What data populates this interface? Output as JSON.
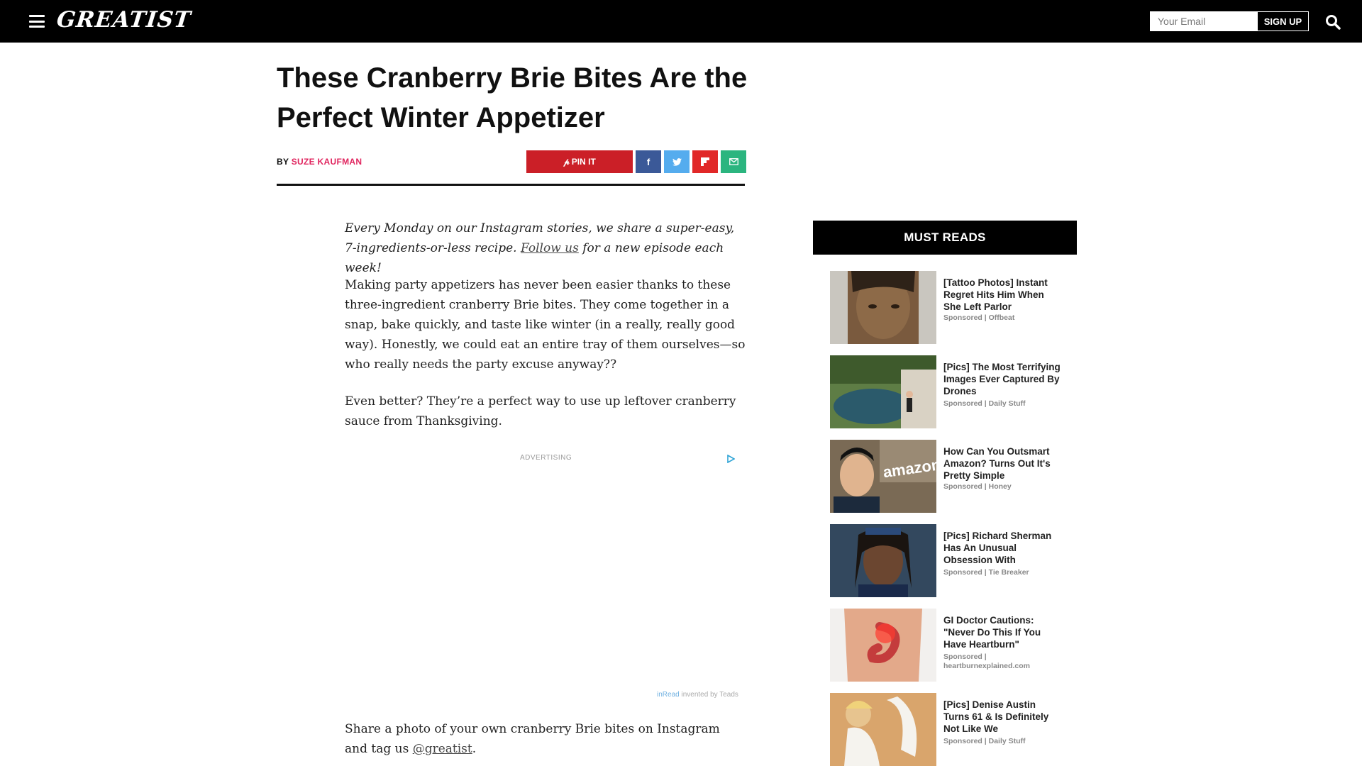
{
  "header": {
    "logo": "GREATIST",
    "email_placeholder": "Your Email",
    "signup_label": "SIGN UP"
  },
  "article": {
    "title": "These Cranberry Brie Bites Are the Perfect Winter Appetizer",
    "byline_prefix": "BY",
    "author": "SUZE KAUFMAN",
    "pin_label": "PIN IT",
    "intro_before": "Every Monday on our Instagram stories, we share a super-easy, 7-ingredients-or-less recipe. ",
    "intro_link": "Follow us",
    "intro_after": " for a new episode each week!",
    "para1": "Making party appetizers has never been easier thanks to these three-ingredient cranberry Brie bites. They come together in a snap, bake quickly, and taste like winter (in a really, really good way). Honestly, we could eat an entire tray of them ourselves—so who really needs the party excuse anyway??",
    "para2": "Even better? They’re a perfect way to use up leftover cranberry sauce from Thanksgiving.",
    "para3_before": "Share a photo of your own cranberry Brie bites on Instagram and tag us ",
    "para3_link": "@greatist",
    "para3_after": "."
  },
  "ad": {
    "label": "ADVERTISING",
    "footer_inread": "inRead",
    "footer_rest": " invented by Teads"
  },
  "sidebar": {
    "title": "MUST READS",
    "items": [
      {
        "headline": "[Tattoo Photos] Instant Regret Hits Him When She Left Parlor",
        "source": "Sponsored | Offbeat"
      },
      {
        "headline": "[Pics] The Most Terrifying Images Ever Captured By Drones",
        "source": "Sponsored | Daily Stuff"
      },
      {
        "headline": "How Can You Outsmart Amazon? Turns Out It's Pretty Simple",
        "source": "Sponsored | Honey"
      },
      {
        "headline": "[Pics] Richard Sherman Has An Unusual Obsession With",
        "source": "Sponsored | Tie Breaker"
      },
      {
        "headline": "GI Doctor Cautions: \"Never Do This If You Have Heartburn\"",
        "source": "Sponsored | heartburnexplained.com"
      },
      {
        "headline": "[Pics] Denise Austin Turns 61 & Is Definitely Not Like We",
        "source": "Sponsored | Daily Stuff"
      }
    ]
  }
}
